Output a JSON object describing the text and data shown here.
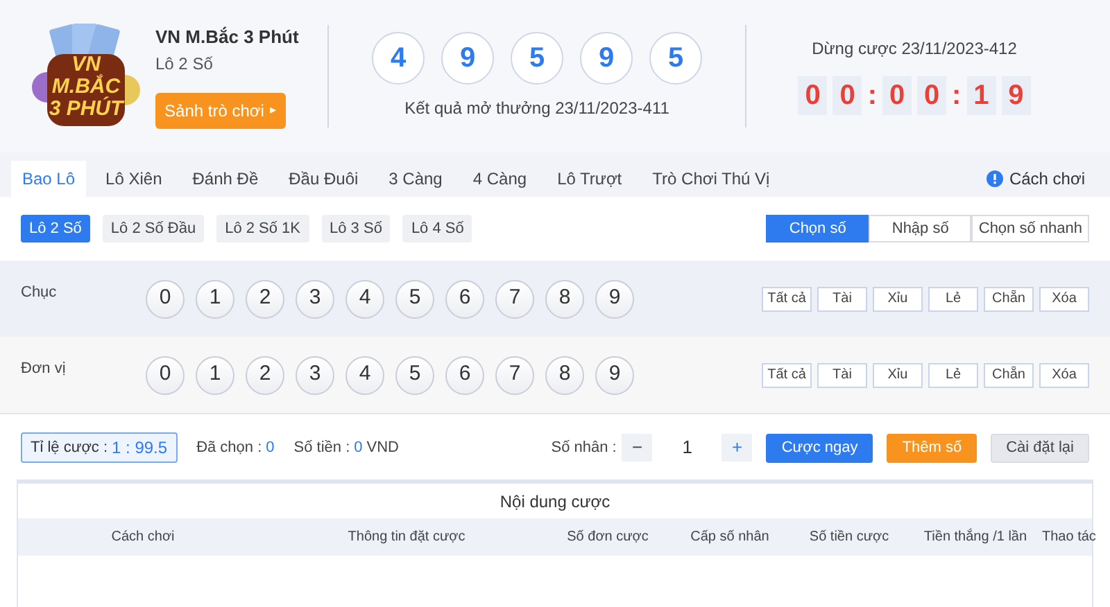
{
  "game": {
    "logo_lines": [
      "VN",
      "M.BẮC",
      "3 PHÚT"
    ],
    "title": "VN M.Bắc 3 Phút",
    "subtitle": "Lô 2 Số",
    "lobby_button": "Sảnh trò chơi",
    "lobby_arrow": "▸"
  },
  "result": {
    "numbers": [
      "4",
      "9",
      "5",
      "9",
      "5"
    ],
    "caption": "Kết quả mở thưởng 23/11/2023-411"
  },
  "countdown": {
    "caption": "Dừng cược 23/11/2023-412",
    "digits": [
      {
        "kind": "digit",
        "text": "0"
      },
      {
        "kind": "digit",
        "text": "0"
      },
      {
        "kind": "separator",
        "text": ":"
      },
      {
        "kind": "digit",
        "text": "0"
      },
      {
        "kind": "digit",
        "text": "0"
      },
      {
        "kind": "separator",
        "text": ":"
      },
      {
        "kind": "digit",
        "text": "1"
      },
      {
        "kind": "digit",
        "text": "9"
      }
    ]
  },
  "tabs": [
    {
      "label": "Bao Lô",
      "selected": true
    },
    {
      "label": "Lô Xiên",
      "selected": false
    },
    {
      "label": "Đánh Đề",
      "selected": false
    },
    {
      "label": "Đầu Đuôi",
      "selected": false
    },
    {
      "label": "3 Càng",
      "selected": false
    },
    {
      "label": "4 Càng",
      "selected": false
    },
    {
      "label": "Lô Trượt",
      "selected": false
    },
    {
      "label": "Trò Chơi Thú Vị",
      "selected": false
    }
  ],
  "help_link": "Cách chơi",
  "subtabs": [
    {
      "label": "Lô 2 Số",
      "selected": true
    },
    {
      "label": "Lô 2 Số Đầu",
      "selected": false
    },
    {
      "label": "Lô 2 Số 1K",
      "selected": false
    },
    {
      "label": "Lô 3 Số",
      "selected": false
    },
    {
      "label": "Lô 4 Số",
      "selected": false
    }
  ],
  "modes": [
    {
      "label": "Chọn số",
      "selected": true
    },
    {
      "label": "Nhập số",
      "selected": false
    },
    {
      "label": "Chọn số nhanh",
      "selected": false
    }
  ],
  "rows": [
    {
      "label": "Chục",
      "balls": [
        "0",
        "1",
        "2",
        "3",
        "4",
        "5",
        "6",
        "7",
        "8",
        "9"
      ],
      "actions": [
        "Tất cả",
        "Tài",
        "Xỉu",
        "Lẻ",
        "Chẵn",
        "Xóa"
      ]
    },
    {
      "label": "Đơn vị",
      "balls": [
        "0",
        "1",
        "2",
        "3",
        "4",
        "5",
        "6",
        "7",
        "8",
        "9"
      ],
      "actions": [
        "Tất cả",
        "Tài",
        "Xỉu",
        "Lẻ",
        "Chẵn",
        "Xóa"
      ]
    }
  ],
  "bet_bar": {
    "odds_label": "Tỉ lệ cược :",
    "odds_value": "1 : 99.5",
    "chosen_label": "Đã chọn :",
    "chosen_value": "0",
    "amount_label": "Số tiền :",
    "amount_value": "0",
    "amount_unit": "VND",
    "multiplier_label": "Số nhân :",
    "minus": "−",
    "multiplier_value": "1",
    "plus": "+",
    "buttons": [
      {
        "label": "Cược ngay",
        "kind": "primary"
      },
      {
        "label": "Thêm số",
        "kind": "warning"
      },
      {
        "label": "Cài đặt lại",
        "kind": "default"
      }
    ]
  },
  "table": {
    "title": "Nội dung cược",
    "columns": [
      "Cách chơi",
      "Thông tin đặt cược",
      "Số đơn cược",
      "Cấp số nhân",
      "Số tiền cược",
      "Tiền thắng /1 lần",
      "Thao tác"
    ]
  }
}
